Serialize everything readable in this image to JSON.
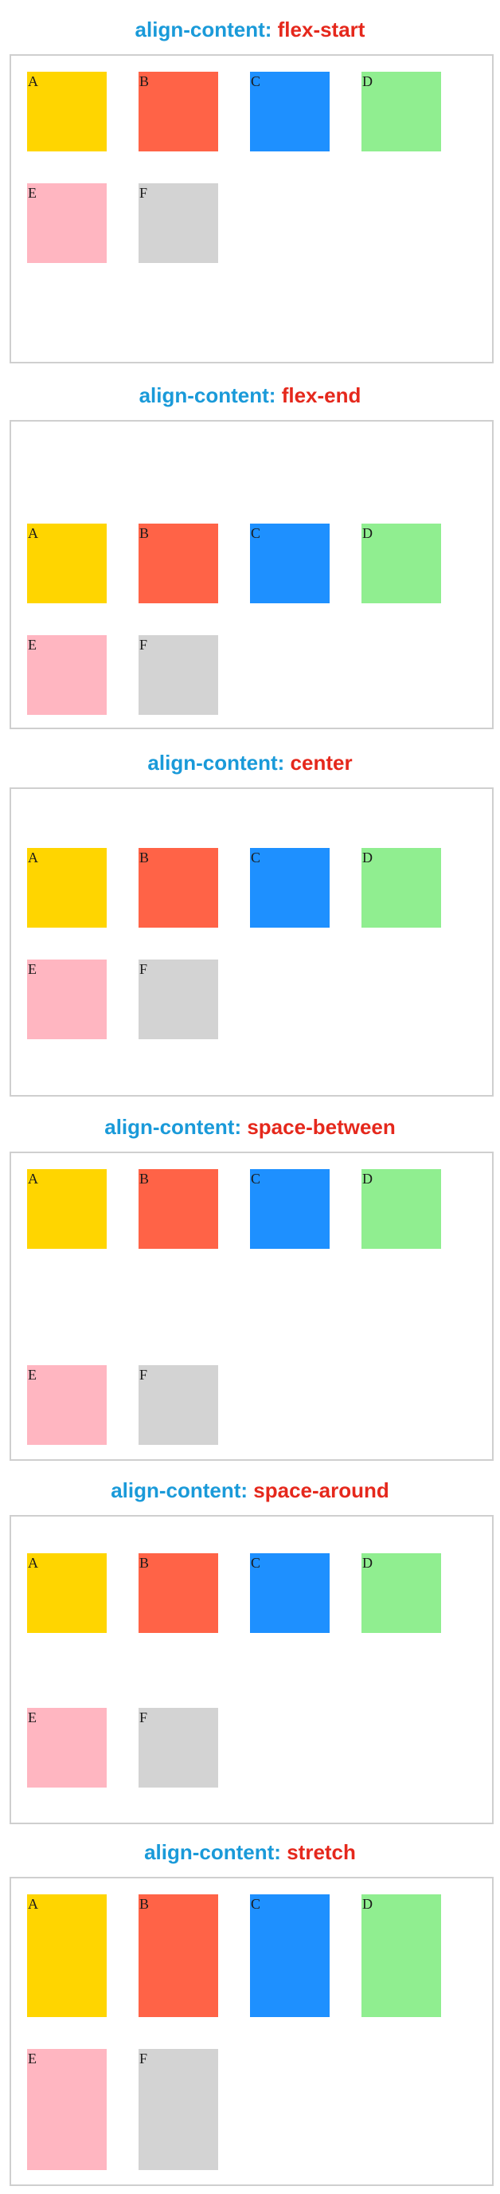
{
  "property_label": "align-content:",
  "item_colors": {
    "A": "#ffd500",
    "B": "#ff6347",
    "C": "#1e90ff",
    "D": "#90ee90",
    "E": "#ffb6c1",
    "F": "#d3d3d3"
  },
  "panels": [
    {
      "value": "flex-start",
      "items": [
        {
          "label": "A"
        },
        {
          "label": "B"
        },
        {
          "label": "C"
        },
        {
          "label": "D"
        },
        {
          "label": "E"
        },
        {
          "label": "F"
        }
      ]
    },
    {
      "value": "flex-end",
      "items": [
        {
          "label": "A"
        },
        {
          "label": "B"
        },
        {
          "label": "C"
        },
        {
          "label": "D"
        },
        {
          "label": "E"
        },
        {
          "label": "F"
        }
      ]
    },
    {
      "value": "center",
      "items": [
        {
          "label": "A"
        },
        {
          "label": "B"
        },
        {
          "label": "C"
        },
        {
          "label": "D"
        },
        {
          "label": "E"
        },
        {
          "label": "F"
        }
      ]
    },
    {
      "value": "space-between",
      "items": [
        {
          "label": "A"
        },
        {
          "label": "B"
        },
        {
          "label": "C"
        },
        {
          "label": "D"
        },
        {
          "label": "E"
        },
        {
          "label": "F"
        }
      ]
    },
    {
      "value": "space-around",
      "items": [
        {
          "label": "A"
        },
        {
          "label": "B"
        },
        {
          "label": "C"
        },
        {
          "label": "D"
        },
        {
          "label": "E"
        },
        {
          "label": "F"
        }
      ]
    },
    {
      "value": "stretch",
      "items": [
        {
          "label": "A"
        },
        {
          "label": "B"
        },
        {
          "label": "C"
        },
        {
          "label": "D"
        },
        {
          "label": "E"
        },
        {
          "label": "F"
        }
      ]
    }
  ]
}
